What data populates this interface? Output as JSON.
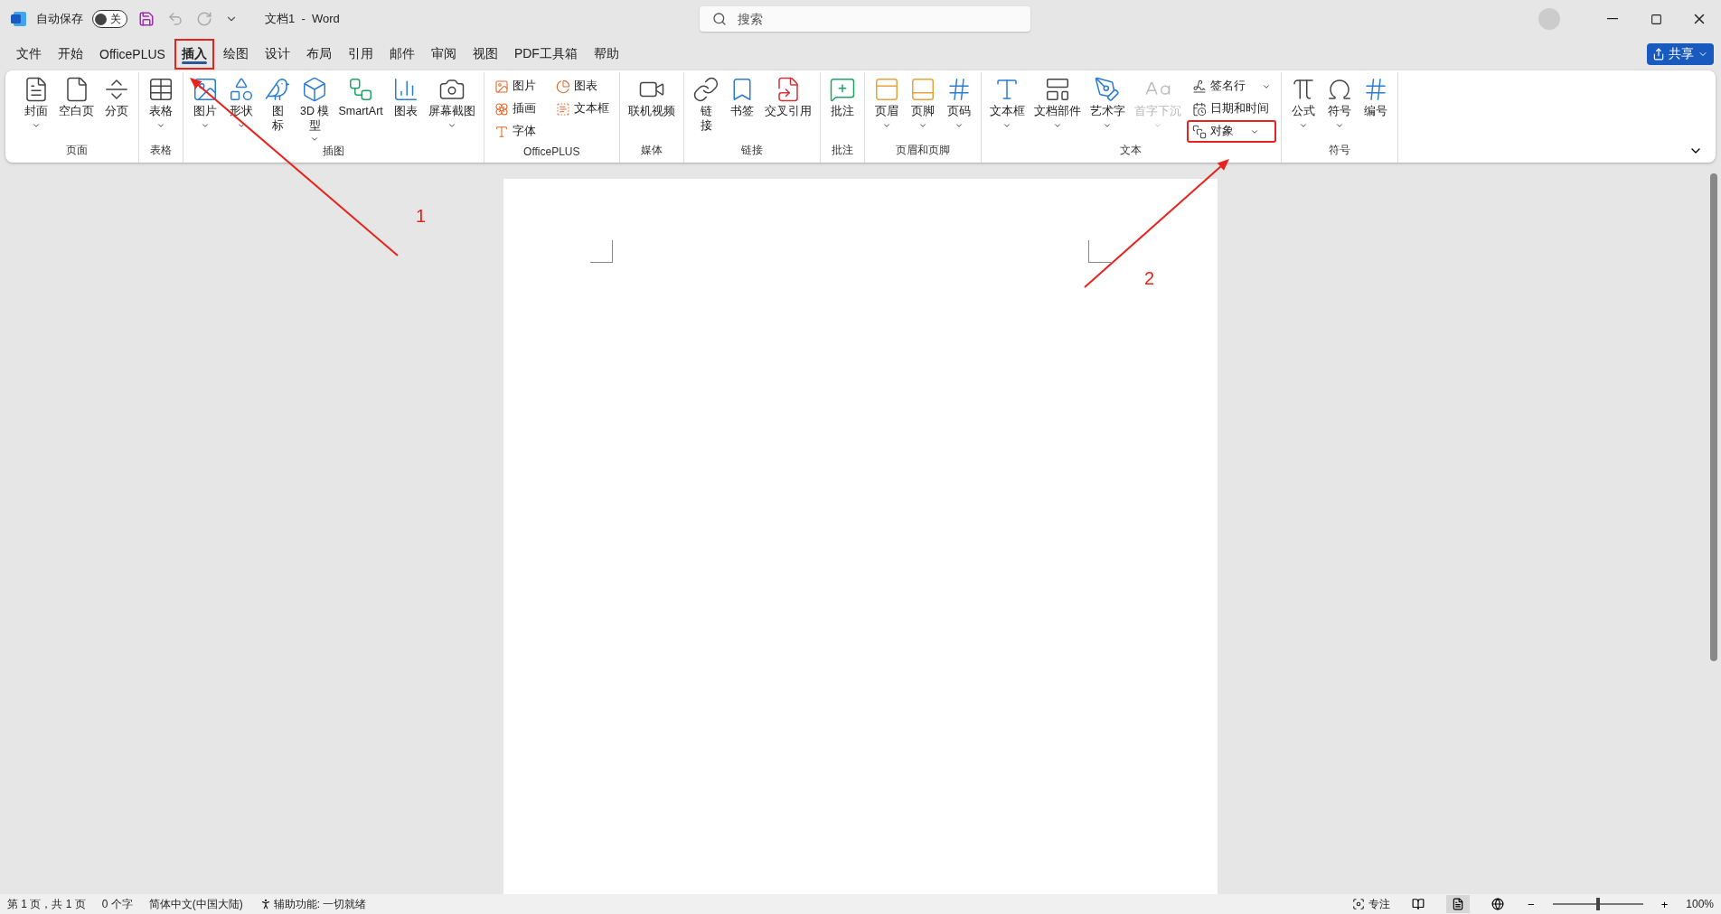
{
  "title_bar": {
    "autosave_label": "自动保存",
    "autosave_toggle": {
      "label": "关",
      "on": false
    },
    "document_title": "文档1  -  Word",
    "search": {
      "placeholder": "搜索"
    }
  },
  "tabs": [
    {
      "label": "文件",
      "selected": false,
      "annotated": false
    },
    {
      "label": "开始",
      "selected": false,
      "annotated": false
    },
    {
      "label": "OfficePLUS",
      "selected": false,
      "annotated": false
    },
    {
      "label": "插入",
      "selected": true,
      "annotated": true
    },
    {
      "label": "绘图",
      "selected": false,
      "annotated": false
    },
    {
      "label": "设计",
      "selected": false,
      "annotated": false
    },
    {
      "label": "布局",
      "selected": false,
      "annotated": false
    },
    {
      "label": "引用",
      "selected": false,
      "annotated": false
    },
    {
      "label": "邮件",
      "selected": false,
      "annotated": false
    },
    {
      "label": "审阅",
      "selected": false,
      "annotated": false
    },
    {
      "label": "视图",
      "selected": false,
      "annotated": false
    },
    {
      "label": "PDF工具箱",
      "selected": false,
      "annotated": false
    },
    {
      "label": "帮助",
      "selected": false,
      "annotated": false
    }
  ],
  "share_button": {
    "label": "共享"
  },
  "ribbon_groups": [
    {
      "label": "页面",
      "items": [
        {
          "kind": "large",
          "label": "封面",
          "dropdown": true
        },
        {
          "kind": "large",
          "label": "空白页",
          "dropdown": false
        },
        {
          "kind": "large",
          "label": "分页",
          "dropdown": false
        }
      ]
    },
    {
      "label": "表格",
      "items": [
        {
          "kind": "large",
          "label": "表格",
          "dropdown": true
        }
      ]
    },
    {
      "label": "插图",
      "items": [
        {
          "kind": "large",
          "label": "图片",
          "dropdown": true
        },
        {
          "kind": "large",
          "label": "形状",
          "dropdown": true
        },
        {
          "kind": "large",
          "label": "图标",
          "dropdown": false
        },
        {
          "kind": "large",
          "label": "3D 模型",
          "dropdown": true
        },
        {
          "kind": "large",
          "label": "SmartArt",
          "dropdown": false
        },
        {
          "kind": "large",
          "label": "图表",
          "dropdown": false
        },
        {
          "kind": "large",
          "label": "屏幕截图",
          "dropdown": true
        }
      ]
    },
    {
      "label": "OfficePLUS",
      "items": [
        {
          "kind": "small",
          "label": "图片",
          "dropdown": false
        },
        {
          "kind": "small",
          "label": "插画",
          "dropdown": false
        },
        {
          "kind": "small",
          "label": "字体",
          "dropdown": false
        },
        {
          "kind": "small",
          "label": "图表",
          "dropdown": false
        },
        {
          "kind": "small",
          "label": "文本框",
          "dropdown": false
        }
      ]
    },
    {
      "label": "媒体",
      "items": [
        {
          "kind": "large",
          "label": "联机视频",
          "dropdown": false
        }
      ]
    },
    {
      "label": "链接",
      "items": [
        {
          "kind": "large",
          "label": "链接",
          "dropdown": false
        },
        {
          "kind": "large",
          "label": "书签",
          "dropdown": false
        },
        {
          "kind": "large",
          "label": "交叉引用",
          "dropdown": false
        }
      ]
    },
    {
      "label": "批注",
      "items": [
        {
          "kind": "large",
          "label": "批注",
          "dropdown": false
        }
      ]
    },
    {
      "label": "页眉和页脚",
      "items": [
        {
          "kind": "large",
          "label": "页眉",
          "dropdown": true
        },
        {
          "kind": "large",
          "label": "页脚",
          "dropdown": true
        },
        {
          "kind": "large",
          "label": "页码",
          "dropdown": true
        }
      ]
    },
    {
      "label": "文本",
      "items": [
        {
          "kind": "large",
          "label": "文本框",
          "dropdown": true
        },
        {
          "kind": "large",
          "label": "文档部件",
          "dropdown": true
        },
        {
          "kind": "large",
          "label": "艺术字",
          "dropdown": true
        },
        {
          "kind": "large",
          "label": "首字下沉",
          "dropdown": true,
          "disabled": true
        },
        {
          "kind": "small",
          "label": "签名行",
          "dropdown": true
        },
        {
          "kind": "small",
          "label": "日期和时间",
          "dropdown": false
        },
        {
          "kind": "small",
          "label": "对象",
          "dropdown": true,
          "annotated": true
        }
      ]
    },
    {
      "label": "符号",
      "items": [
        {
          "kind": "large",
          "label": "公式",
          "dropdown": true
        },
        {
          "kind": "large",
          "label": "符号",
          "dropdown": true
        },
        {
          "kind": "large",
          "label": "编号",
          "dropdown": false
        }
      ]
    }
  ],
  "annotations": [
    {
      "label": "1"
    },
    {
      "label": "2"
    }
  ],
  "status_bar": {
    "left": [
      "第 1 页，共 1 页",
      "0 个字",
      "简体中文(中国大陆)"
    ],
    "accessibility": "辅助功能: 一切就绪",
    "focus": "专注",
    "views": [
      {
        "kind": "read",
        "selected": false
      },
      {
        "kind": "print",
        "selected": true
      },
      {
        "kind": "web",
        "selected": false
      }
    ],
    "zoom": {
      "minus": "−",
      "plus": "+",
      "level": 0.5,
      "reading": "100%"
    }
  }
}
